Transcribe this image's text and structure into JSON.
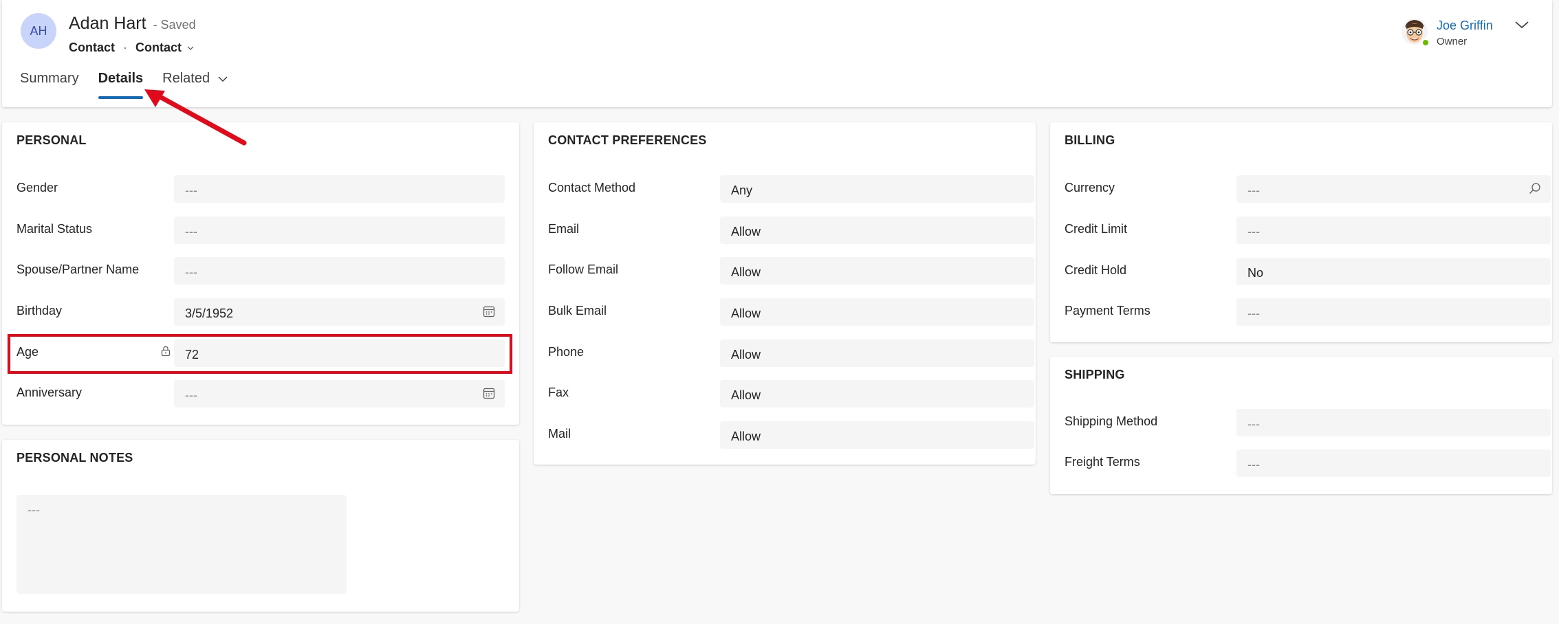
{
  "header": {
    "avatar_initials": "AH",
    "record_name": "Adan Hart",
    "save_status": "- Saved",
    "entity": "Contact",
    "separator": "·",
    "form_name": "Contact",
    "owner_name": "Joe Griffin",
    "owner_role": "Owner"
  },
  "tabs": [
    {
      "label": "Summary"
    },
    {
      "label": "Details"
    },
    {
      "label": "Related"
    }
  ],
  "personal": {
    "title": "PERSONAL",
    "gender": {
      "label": "Gender",
      "value": "---"
    },
    "marital_status": {
      "label": "Marital Status",
      "value": "---"
    },
    "spouse": {
      "label": "Spouse/Partner Name",
      "value": "---"
    },
    "birthday": {
      "label": "Birthday",
      "value": "3/5/1952"
    },
    "age": {
      "label": "Age",
      "value": "72"
    },
    "anniversary": {
      "label": "Anniversary",
      "value": "---"
    }
  },
  "personal_notes": {
    "title": "PERSONAL NOTES",
    "value": "---"
  },
  "contact_preferences": {
    "title": "CONTACT PREFERENCES",
    "contact_method": {
      "label": "Contact Method",
      "value": "Any"
    },
    "email": {
      "label": "Email",
      "value": "Allow"
    },
    "follow_email": {
      "label": "Follow Email",
      "value": "Allow"
    },
    "bulk_email": {
      "label": "Bulk Email",
      "value": "Allow"
    },
    "phone": {
      "label": "Phone",
      "value": "Allow"
    },
    "fax": {
      "label": "Fax",
      "value": "Allow"
    },
    "mail": {
      "label": "Mail",
      "value": "Allow"
    }
  },
  "billing": {
    "title": "BILLING",
    "currency": {
      "label": "Currency",
      "value": "---"
    },
    "credit_limit": {
      "label": "Credit Limit",
      "value": "---"
    },
    "credit_hold": {
      "label": "Credit Hold",
      "value": "No"
    },
    "payment_terms": {
      "label": "Payment Terms",
      "value": "---"
    }
  },
  "shipping": {
    "title": "SHIPPING",
    "shipping_method": {
      "label": "Shipping Method",
      "value": "---"
    },
    "freight_terms": {
      "label": "Freight Terms",
      "value": "---"
    }
  },
  "colors": {
    "accent": "#0f6cbd",
    "annotation": "#e00a1a",
    "avatar_bg": "#c9d4fb",
    "presence": "#6bb700"
  }
}
